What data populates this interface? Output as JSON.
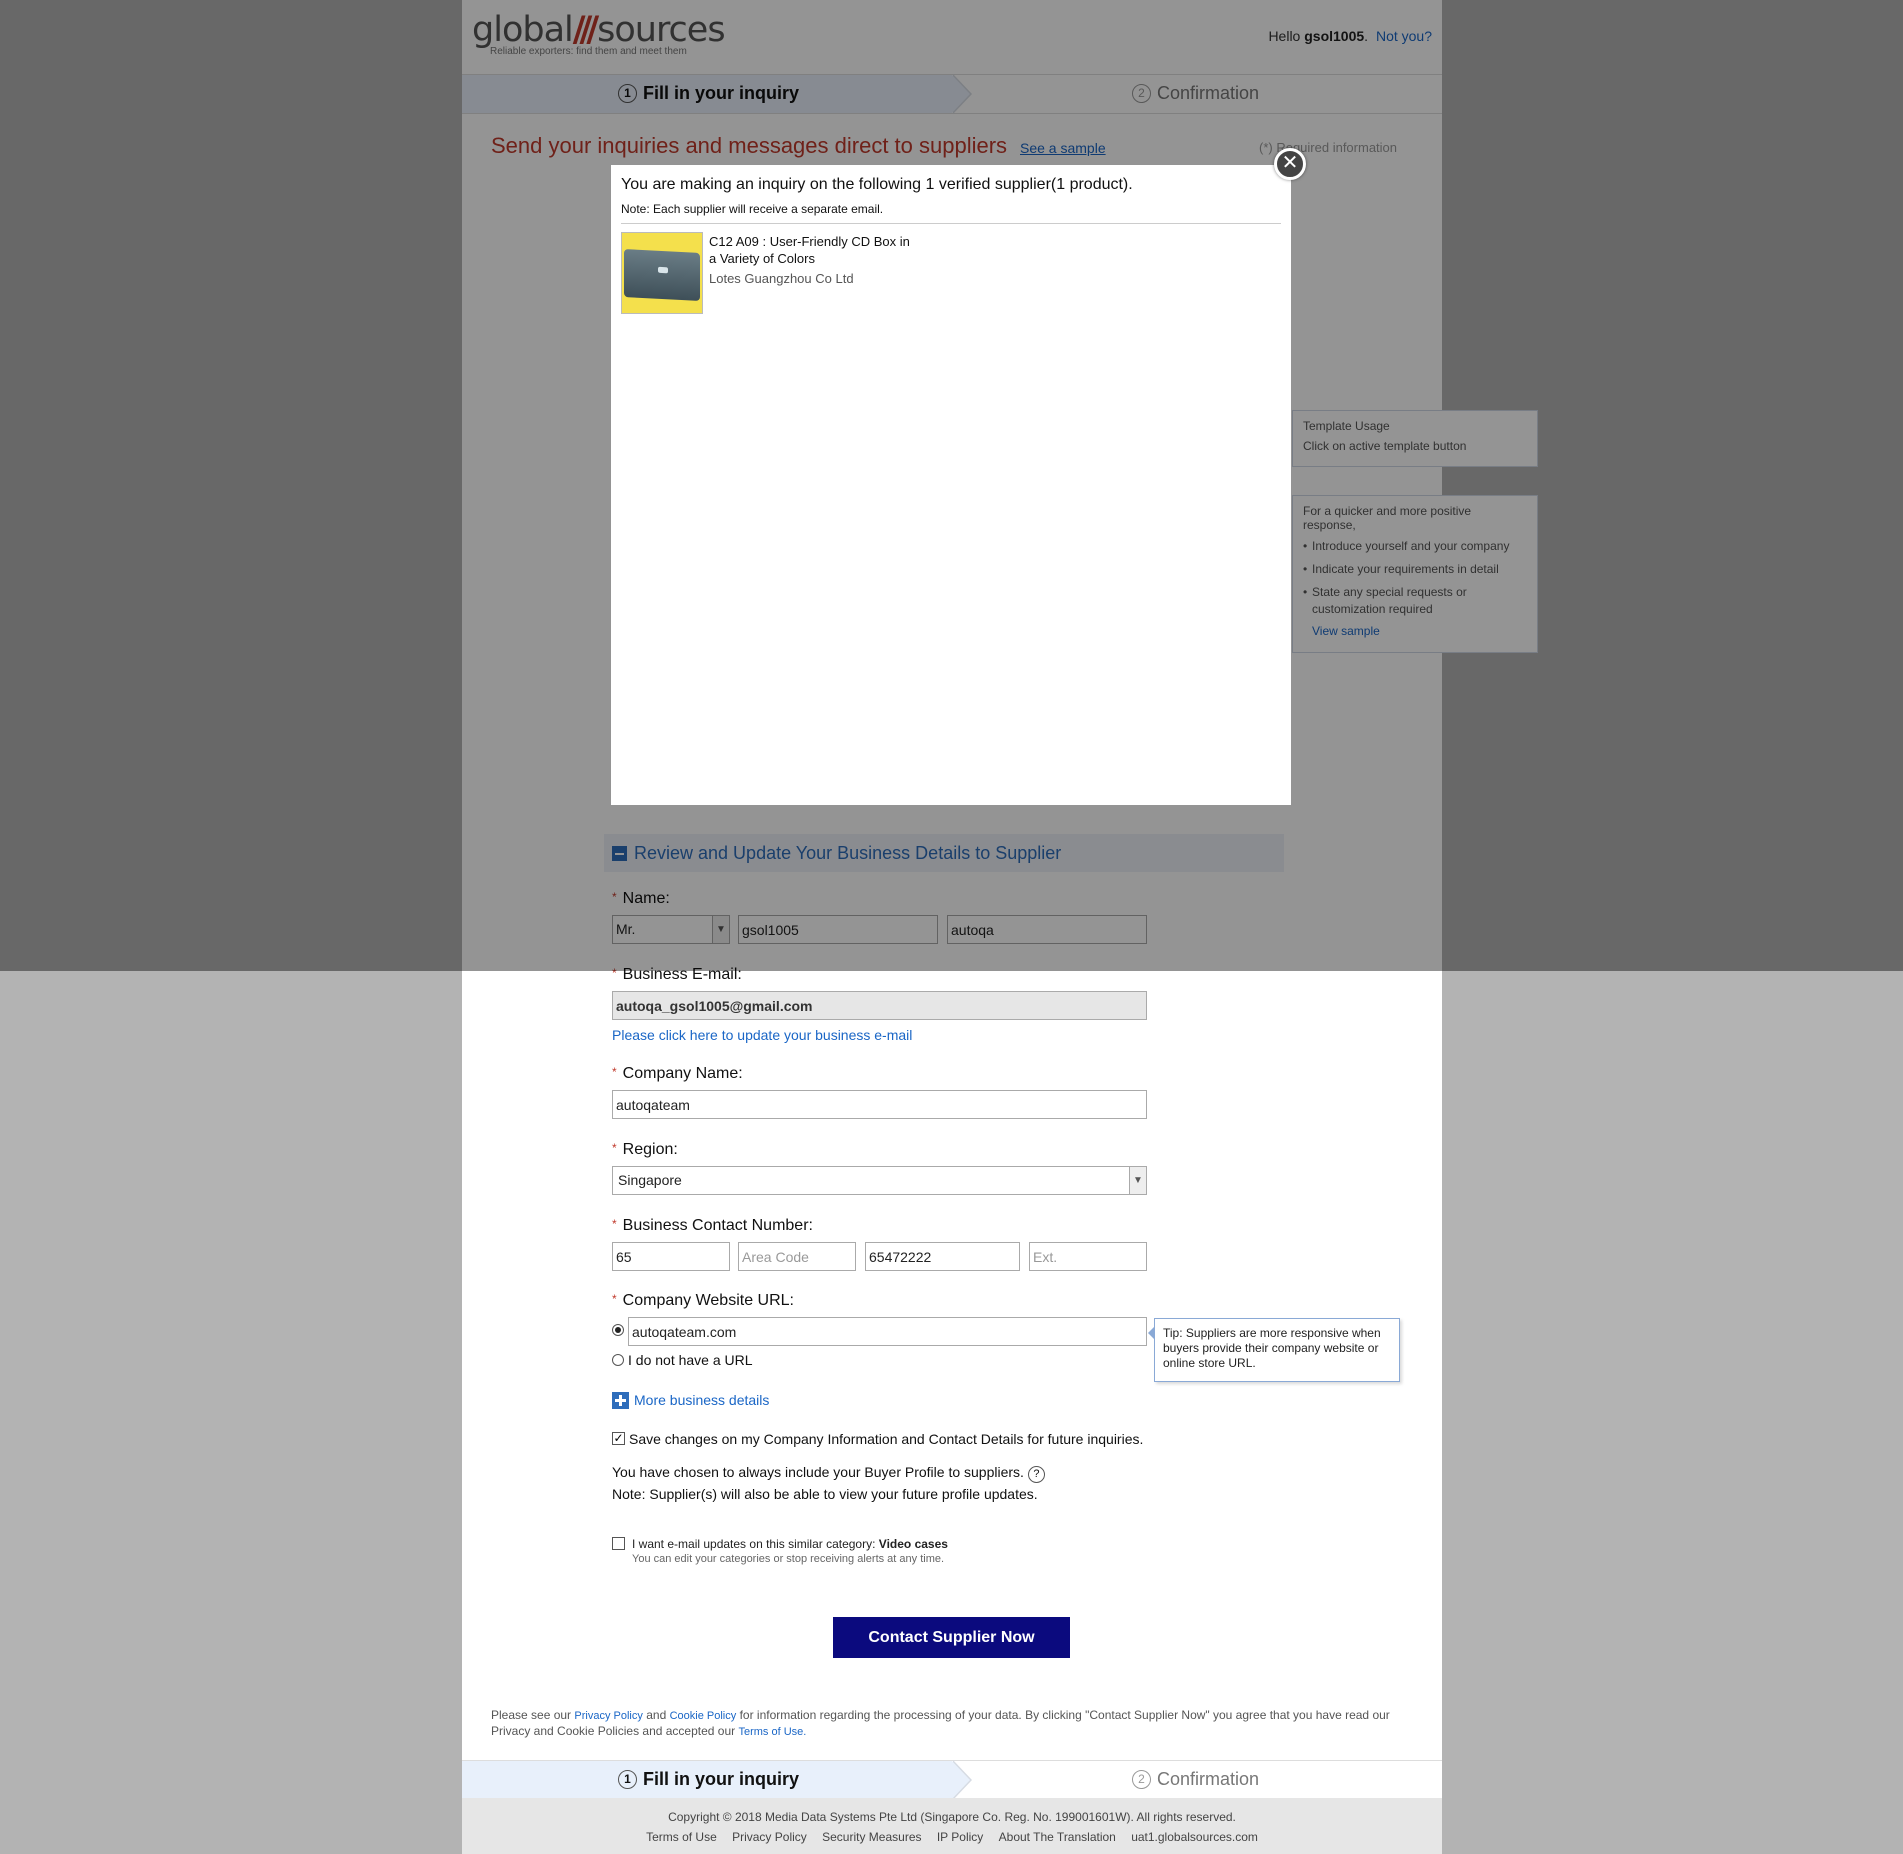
{
  "header": {
    "logo_left": "global",
    "logo_right": "sources",
    "tagline": "Reliable exporters: find them and meet them",
    "greeting": "Hello",
    "username": "gsol1005",
    "not_you": "Not you?"
  },
  "steps": {
    "step1_num": "1",
    "step1": "Fill in your inquiry",
    "step2_num": "2",
    "step2": "Confirmation"
  },
  "main": {
    "headline": "Send your inquiries and messages direct to suppliers",
    "see_sample": "See a sample",
    "required_info": "(*) Required information"
  },
  "side": {
    "template_title": "Template Usage",
    "template_text": "Click on active template button",
    "tips_title": "For a quicker and more positive response,",
    "tips": [
      "Introduce yourself and your company",
      "Indicate your requirements in detail",
      "State any special requests or customization required"
    ],
    "view_sample": "View sample"
  },
  "business": {
    "section_title": "Review and Update Your Business Details to Supplier",
    "name_label": "Name:",
    "salutation": "Mr.",
    "first_name": "gsol1005",
    "last_name": "autoqa",
    "email_label": "Business E-mail:",
    "email": "autoqa_gsol1005@gmail.com",
    "update_email": "Please click here to update your business e-mail",
    "company_label": "Company Name:",
    "company": "autoqateam",
    "region_label": "Region:",
    "region": "Singapore",
    "contact_label": "Business Contact Number:",
    "country_code": "65",
    "area_placeholder": "Area Code",
    "phone": "65472222",
    "ext_placeholder": "Ext.",
    "website_label": "Company Website URL:",
    "website": "autoqateam.com",
    "no_url": "I do not have a URL",
    "tip": "Tip: Suppliers are more responsive when buyers provide their company website or online store URL.",
    "more_details": "More business details",
    "save_changes": "Save changes on my Company Information and Contact Details for future inquiries.",
    "profile_text": "You have chosen to always include your Buyer Profile to suppliers.",
    "help_glyph": "?",
    "profile_note": "Note: Supplier(s) will also be able to view your future profile updates.",
    "updates_text": "I want e-mail updates on this similar category:",
    "updates_category": "Video cases",
    "updates_sub": "You can edit your categories or stop receiving alerts at any time.",
    "save_checked": true,
    "updates_checked": false
  },
  "cta": {
    "label": "Contact Supplier Now"
  },
  "policy": {
    "p1": "Please see our",
    "privacy": "Privacy Policy",
    "and": "and",
    "cookie": "Cookie Policy",
    "p2": "for information regarding the processing of your data. By clicking \"Contact Supplier Now\" you agree that you have read our Privacy and Cookie Policies and accepted our",
    "terms": "Terms of Use."
  },
  "footer": {
    "copyright": "Copyright © 2018 Media Data Systems Pte Ltd (Singapore Co. Reg. No. 199001601W). All rights reserved.",
    "links": [
      "Terms of Use",
      "Privacy Policy",
      "Security Measures",
      "IP Policy",
      "About The Translation",
      "uat1.globalsources.com"
    ]
  },
  "modal": {
    "close_glyph": "✕",
    "title": "You are making an inquiry on the following 1 verified supplier(1 product).",
    "note": "Note: Each supplier will receive a separate email.",
    "product": "C12 A09 : User-Friendly CD Box in a Variety of Colors",
    "supplier": "Lotes Guangzhou Co Ltd"
  },
  "colors": {
    "headline": "#c0392b",
    "link": "#1a66c6",
    "cta": "#0b0a7e",
    "section": "#2e6dbb"
  }
}
